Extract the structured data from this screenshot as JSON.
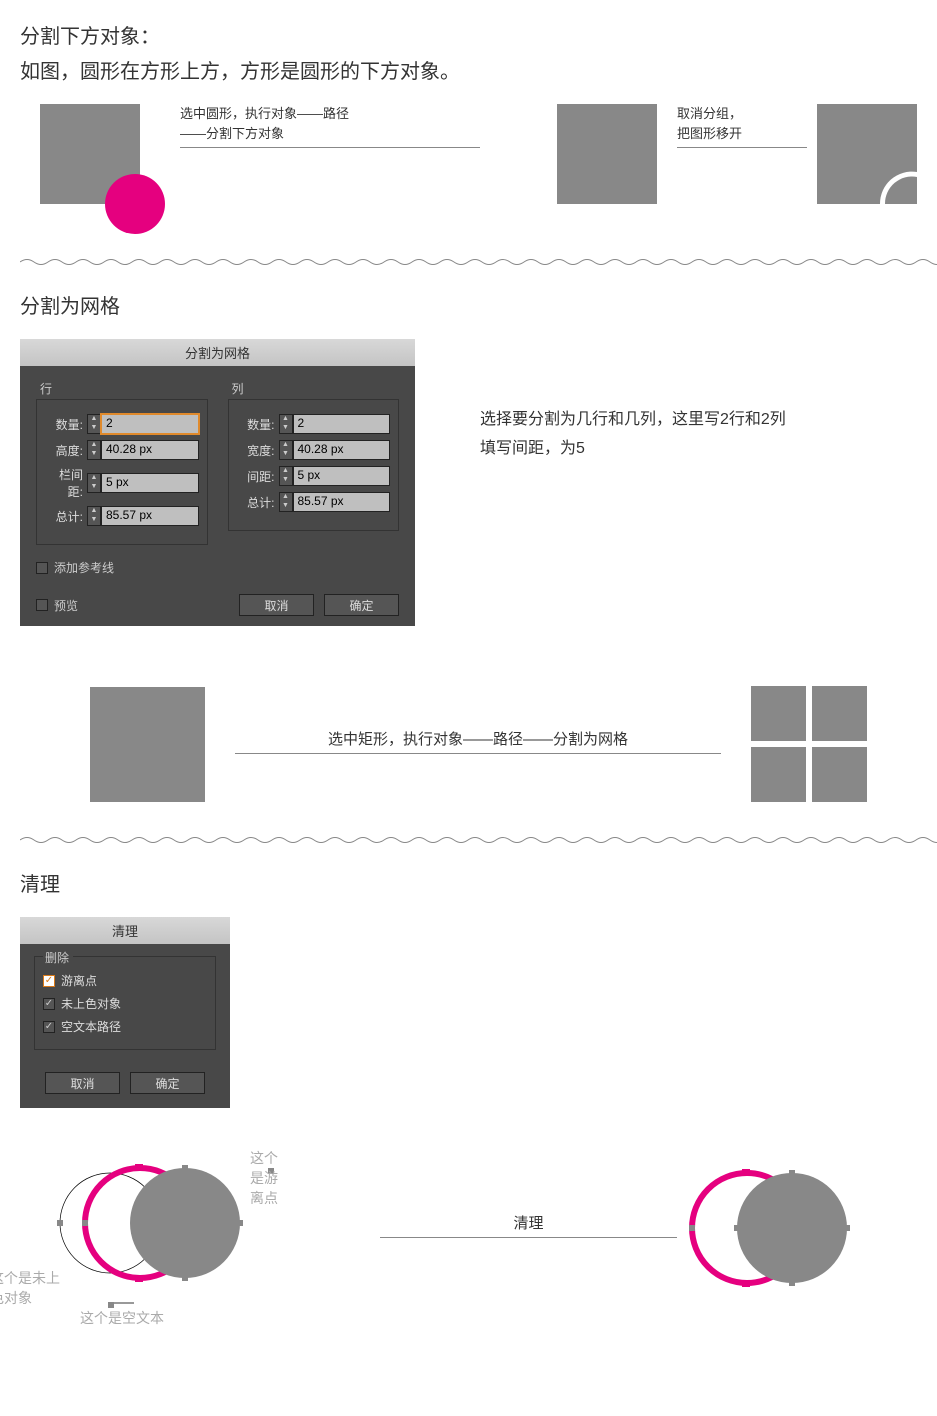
{
  "section1": {
    "title": "分割下方对象：",
    "subtitle": "如图，圆形在方形上方，方形是圆形的下方对象。",
    "caption_left": "选中圆形，执行对象——路径——分割下方对象",
    "caption_right": "取消分组，\n把图形移开"
  },
  "section2": {
    "title": "分割为网格",
    "dialog_title": "分割为网格",
    "col_row_label": "行",
    "col_col_label": "列",
    "fields": {
      "count_label": "数量:",
      "height_label": "高度:",
      "gutter_label": "栏间距:",
      "width_label": "宽度:",
      "gap_label": "间距:",
      "total_label": "总计:",
      "row_count": "2",
      "row_height": "40.28 px",
      "row_gutter": "5 px",
      "row_total": "85.57 px",
      "col_count": "2",
      "col_width": "40.28 px",
      "col_gap": "5 px",
      "col_total": "85.57 px"
    },
    "opt_guides": "添加参考线",
    "opt_preview": "预览",
    "btn_cancel": "取消",
    "btn_ok": "确定",
    "sidenote_line1": "选择要分割为几行和几列，这里写2行和2列",
    "sidenote_line2": "填写间距，为5",
    "caption2": "选中矩形，执行对象——路径——分割为网格"
  },
  "section3": {
    "title": "清理",
    "dialog_title": "清理",
    "group_label": "删除",
    "opt_stray": "游离点",
    "opt_unfilled": "未上色对象",
    "opt_emptytext": "空文本路径",
    "btn_cancel": "取消",
    "btn_ok": "确定",
    "annot_stray": "这个是游离点",
    "annot_unfilled": "这个是未上色对象",
    "annot_emptytext": "这个是空文本",
    "mid_label": "清理"
  }
}
